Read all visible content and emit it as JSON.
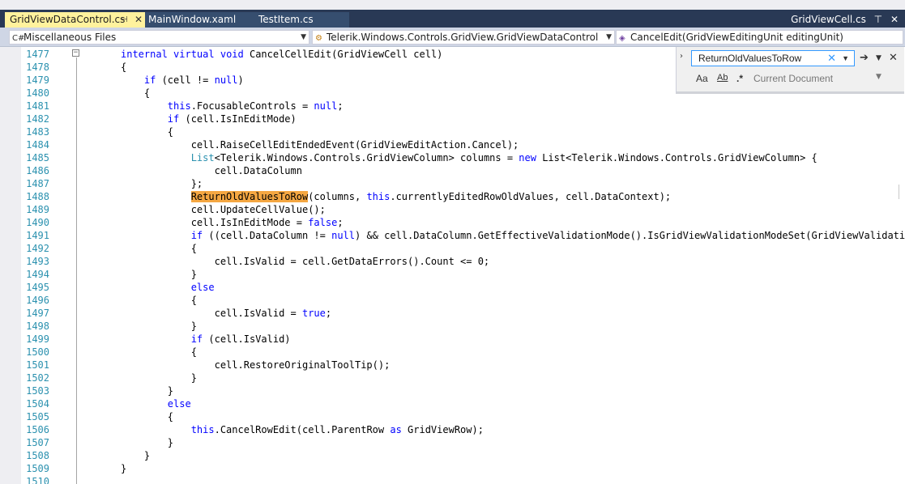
{
  "tabs": {
    "active": {
      "label": "GridViewDataControl.cs",
      "pin_icon": "pin-icon",
      "close_icon": "close-icon"
    },
    "others": [
      {
        "label": "MainWindow.xaml"
      },
      {
        "label": "TestItem.cs"
      }
    ],
    "right_tab": {
      "label": "GridViewCell.cs",
      "pin_icon": "pin-icon",
      "close_icon": "close-icon"
    }
  },
  "navbar": {
    "project": "Miscellaneous Files",
    "type": "Telerik.Windows.Controls.GridView.GridViewDataControl",
    "member": "CancelEdit(GridViewEditingUnit editingUnit)"
  },
  "find": {
    "query": "ReturnOldValuesToRow",
    "match_case_label": "Aa",
    "whole_word_label": "Ab",
    "regex_label": ".*",
    "scope": "Current Document"
  },
  "colors": {
    "tabbar": "#293955",
    "active_tab": "#fff29d",
    "keyword": "#0000ff",
    "type": "#2b91af",
    "highlight": "#f5a742"
  },
  "code_lines": [
    {
      "n": "1477",
      "html": "<span class=\"k\">internal</span> <span class=\"k\">virtual</span> <span class=\"k\">void</span> CancelCellEdit(GridViewCell cell)"
    },
    {
      "n": "1478",
      "html": "{"
    },
    {
      "n": "1479",
      "html": "    <span class=\"k\">if</span> (cell != <span class=\"k\">null</span>)"
    },
    {
      "n": "1480",
      "html": "    {"
    },
    {
      "n": "1481",
      "html": "        <span class=\"k\">this</span>.FocusableControls = <span class=\"k\">null</span>;"
    },
    {
      "n": "1482",
      "html": "        <span class=\"k\">if</span> (cell.IsInEditMode)"
    },
    {
      "n": "1483",
      "html": "        {"
    },
    {
      "n": "1484",
      "html": "            cell.RaiseCellEditEndedEvent(GridViewEditAction.Cancel);"
    },
    {
      "n": "1485",
      "html": "            <span class=\"t\">List</span>&lt;Telerik.Windows.Controls.GridViewColumn&gt; columns = <span class=\"k\">new</span> List&lt;Telerik.Windows.Controls.GridViewColumn&gt; {"
    },
    {
      "n": "1486",
      "html": "                cell.DataColumn"
    },
    {
      "n": "1487",
      "html": "            };"
    },
    {
      "n": "1488",
      "html": "            <span class=\"hl\">ReturnOldValuesToRow</span>(columns, <span class=\"k\">this</span>.currentlyEditedRowOldValues, cell.DataContext);"
    },
    {
      "n": "1489",
      "html": "            cell.UpdateCellValue();"
    },
    {
      "n": "1490",
      "html": "            cell.IsInEditMode = <span class=\"k\">false</span>;"
    },
    {
      "n": "1491",
      "html": "            <span class=\"k\">if</span> ((cell.DataColumn != <span class=\"k\">null</span>) &amp;&amp; cell.DataColumn.GetEffectiveValidationMode().IsGridViewValidationModeSet(GridViewValidationMo"
    },
    {
      "n": "1492",
      "html": "            {"
    },
    {
      "n": "1493",
      "html": "                cell.IsValid = cell.GetDataErrors().Count &lt;= 0;"
    },
    {
      "n": "1494",
      "html": "            }"
    },
    {
      "n": "1495",
      "html": "            <span class=\"k\">else</span>"
    },
    {
      "n": "1496",
      "html": "            {"
    },
    {
      "n": "1497",
      "html": "                cell.IsValid = <span class=\"k\">true</span>;"
    },
    {
      "n": "1498",
      "html": "            }"
    },
    {
      "n": "1499",
      "html": "            <span class=\"k\">if</span> (cell.IsValid)"
    },
    {
      "n": "1500",
      "html": "            {"
    },
    {
      "n": "1501",
      "html": "                cell.RestoreOriginalToolTip();"
    },
    {
      "n": "1502",
      "html": "            }"
    },
    {
      "n": "1503",
      "html": "        }"
    },
    {
      "n": "1504",
      "html": "        <span class=\"k\">else</span>"
    },
    {
      "n": "1505",
      "html": "        {"
    },
    {
      "n": "1506",
      "html": "            <span class=\"k\">this</span>.CancelRowEdit(cell.ParentRow <span class=\"k\">as</span> GridViewRow);"
    },
    {
      "n": "1507",
      "html": "        }"
    },
    {
      "n": "1508",
      "html": "    }"
    },
    {
      "n": "1509",
      "html": "}"
    },
    {
      "n": "1510",
      "html": ""
    }
  ]
}
